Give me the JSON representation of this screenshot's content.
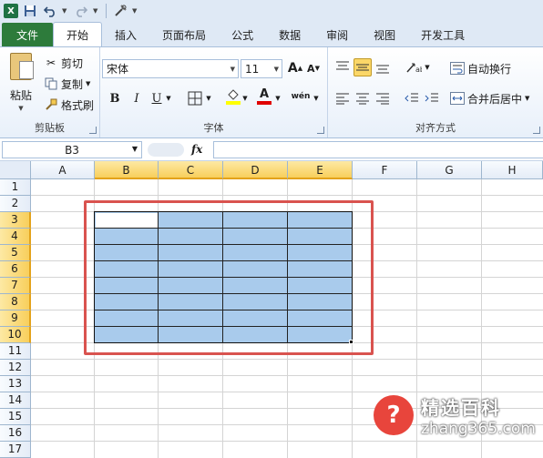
{
  "quick_access": {
    "logo": "X",
    "save_icon": "save-icon",
    "undo_icon": "undo-icon",
    "redo_icon": "redo-icon",
    "customize_icon": "customize-icon"
  },
  "tabs": [
    {
      "label": "文件"
    },
    {
      "label": "开始"
    },
    {
      "label": "插入"
    },
    {
      "label": "页面布局"
    },
    {
      "label": "公式"
    },
    {
      "label": "数据"
    },
    {
      "label": "审阅"
    },
    {
      "label": "视图"
    },
    {
      "label": "开发工具"
    }
  ],
  "clipboard": {
    "paste": "粘贴",
    "cut": "剪切",
    "copy": "复制",
    "format_painter": "格式刷",
    "group": "剪贴板"
  },
  "font": {
    "name": "宋体",
    "size": "11",
    "bold": "B",
    "italic": "I",
    "underline": "U",
    "grow": "A",
    "shrink": "A",
    "font_color": "A",
    "phonetic": "wén",
    "group": "字体"
  },
  "alignment": {
    "wrap_text": "自动换行",
    "merge_center": "合并后居中",
    "group": "对齐方式"
  },
  "formula_bar": {
    "name_box": "B3",
    "fx": "fx",
    "value": ""
  },
  "sheet": {
    "columns": [
      "A",
      "B",
      "C",
      "D",
      "E",
      "F",
      "G",
      "H"
    ],
    "rows": [
      "1",
      "2",
      "3",
      "4",
      "5",
      "6",
      "7",
      "8",
      "9",
      "10",
      "11",
      "12",
      "13",
      "14",
      "15",
      "16",
      "17"
    ],
    "selected_range": "B3:E10",
    "selection_color": "#a9cbec",
    "highlight_color": "#d9534f"
  },
  "watermark": {
    "symbol": "?",
    "title": "精选百科",
    "url": "zhang365.com"
  }
}
